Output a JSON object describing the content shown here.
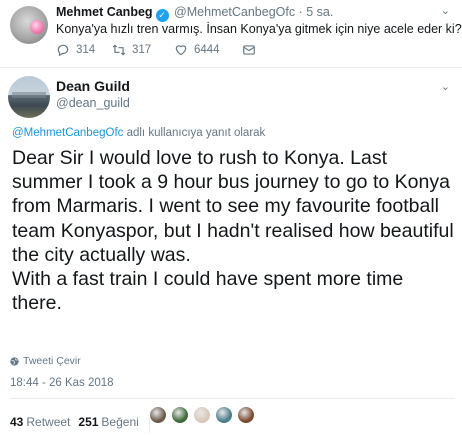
{
  "parent_tweet": {
    "display_name": "Mehmet Canbeg",
    "handle": "@MehmetCanbegOfc",
    "dot": "·",
    "time": "5 sa.",
    "text": "Konya'ya hızlı tren varmış. İnsan Konya'ya gitmek için niye acele eder ki?",
    "replies": "314",
    "retweets": "317",
    "likes": "6444"
  },
  "main_tweet": {
    "display_name": "Dean Guild",
    "handle": "@dean_guild",
    "reply_mention": "@MehmetCanbegOfc",
    "reply_suffix": " adlı kullanıcıya yanıt olarak",
    "paragraphs": [
      "Dear Sir I would love to rush to Konya. Last summer I took a 9 hour bus journey to go to Konya from Marmaris. I went to see my favourite football team Konyaspor, but I hadn't realised how beautiful the city actually was.",
      "With a fast train I could have spent more time there."
    ],
    "translate_label": "Tweeti Çevir",
    "timestamp": "18:44 - 26 Kas 2018",
    "retweet_count": "43",
    "retweet_label": "Retweet",
    "like_count": "251",
    "like_label": "Beğeni"
  },
  "liker_avatar_colors": [
    "#6b5a4a",
    "#3f6b3a",
    "#d9c8b8",
    "#4a7d8c",
    "#7a4a2e"
  ],
  "colors": {
    "accent": "#1da1f2",
    "link": "#1b95e0",
    "muted": "#657786"
  }
}
